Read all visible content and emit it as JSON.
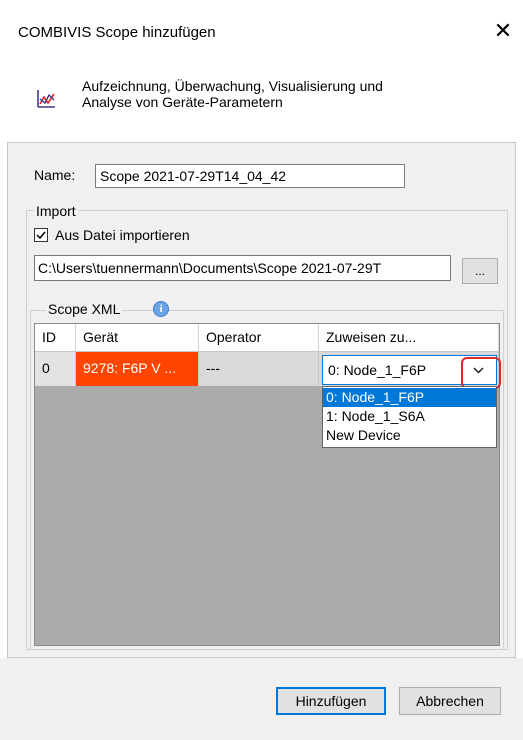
{
  "dialog": {
    "title": "COMBIVIS Scope hinzufügen",
    "close_glyph": "✕",
    "header_line1": "Aufzeichnung, Überwachung, Visualisierung und",
    "header_line2": "Analyse von Geräte-Parametern",
    "header_icon": "chart-line-icon"
  },
  "form": {
    "name_label": "Name:",
    "name_value": "Scope 2021-07-29T14_04_42",
    "import_group_label": "Import",
    "import_checkbox_label": "Aus Datei importieren",
    "import_checkbox_checked": true,
    "file_path": "C:\\Users\\tuennermann\\Documents\\Scope 2021-07-29T",
    "browse_label": "...",
    "scope_xml_label": "Scope XML",
    "info_glyph": "i"
  },
  "grid": {
    "columns": [
      "ID",
      "Gerät",
      "Operator",
      "Zuweisen zu..."
    ],
    "rows": [
      {
        "id": "0",
        "device": "9278: F6P V ...",
        "operator": "---",
        "assign": "0: Node_1_F6P"
      }
    ]
  },
  "dropdown": {
    "selected": "0: Node_1_F6P",
    "options": [
      "0: Node_1_F6P",
      "1: Node_1_S6A",
      "New Device"
    ],
    "selected_index": 0
  },
  "buttons": {
    "add_label": "Hinzufügen",
    "cancel_label": "Abbrechen"
  },
  "colors": {
    "device_cell": "#ff4500",
    "selection": "#0078d7",
    "highlight": "#e0282e"
  }
}
